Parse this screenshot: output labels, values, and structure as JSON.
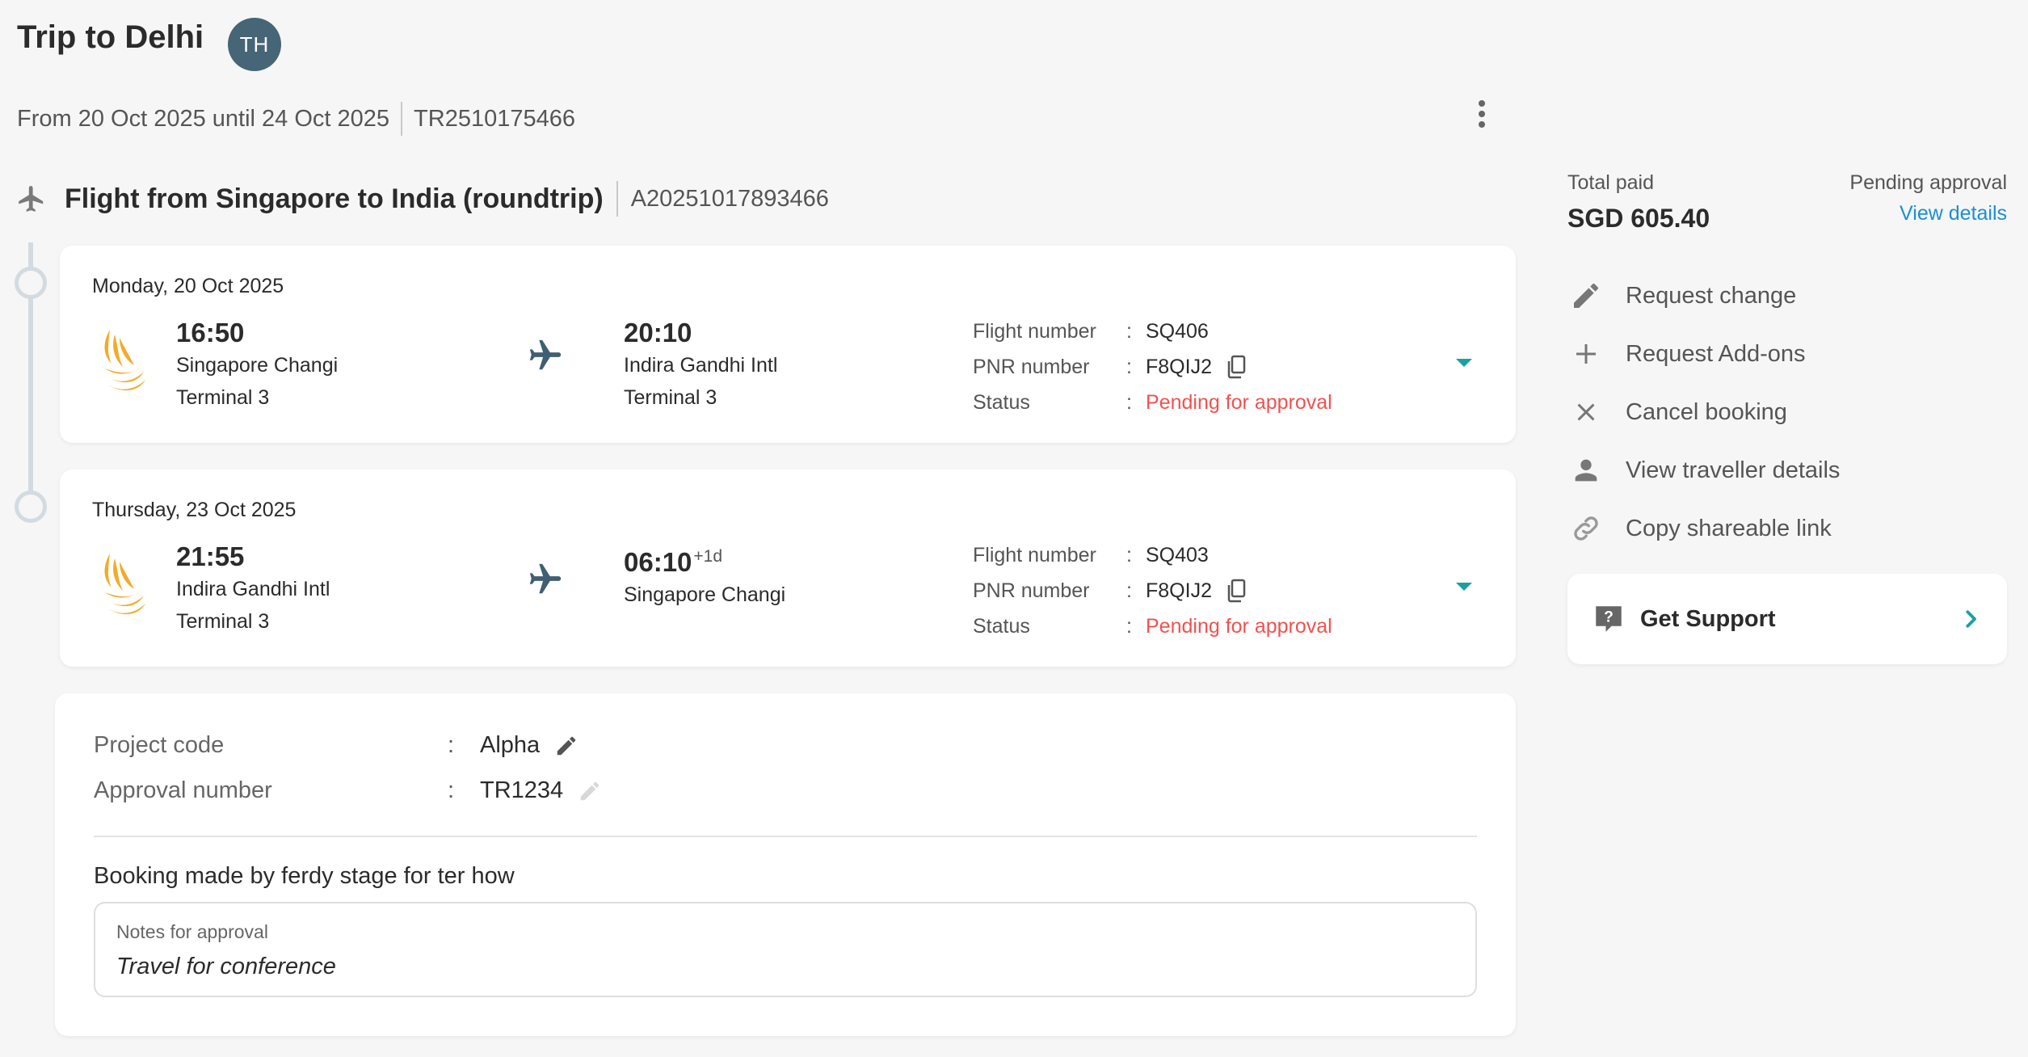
{
  "trip": {
    "title": "Trip to Delhi",
    "avatar_initials": "TH",
    "date_range": "From 20 Oct 2025 until 24 Oct 2025",
    "trip_id": "TR2510175466"
  },
  "flight": {
    "title": "Flight from Singapore to India (roundtrip)",
    "booking_id": "A20251017893466",
    "labels": {
      "flight_number": "Flight number",
      "pnr_number": "PNR number",
      "status": "Status",
      "colon": ":"
    },
    "segments": [
      {
        "date": "Monday, 20 Oct 2025",
        "dep_time": "16:50",
        "dep_airport": "Singapore Changi",
        "dep_terminal": "Terminal 3",
        "arr_time": "20:10",
        "arr_day_offset": "",
        "arr_airport": "Indira Gandhi Intl",
        "arr_terminal": "Terminal 3",
        "flight_number": "SQ406",
        "pnr": "F8QIJ2",
        "status": "Pending for approval"
      },
      {
        "date": "Thursday, 23 Oct 2025",
        "dep_time": "21:55",
        "dep_airport": "Indira Gandhi Intl",
        "dep_terminal": "Terminal 3",
        "arr_time": "06:10",
        "arr_day_offset": "+1d",
        "arr_airport": "Singapore Changi",
        "arr_terminal": "",
        "flight_number": "SQ403",
        "pnr": "F8QIJ2",
        "status": "Pending for approval"
      }
    ]
  },
  "details": {
    "colon": ":",
    "project_code_label": "Project code",
    "project_code_value": "Alpha",
    "approval_number_label": "Approval number",
    "approval_number_value": "TR1234",
    "booked_by": "Booking made by ferdy stage for ter how",
    "notes_label": "Notes for approval",
    "notes_value": "Travel for conference"
  },
  "summary": {
    "total_label": "Total paid",
    "total_value": "SGD 605.40",
    "approval_status": "Pending approval",
    "view_details": "View details"
  },
  "actions": [
    {
      "label": "Request change",
      "icon": "pencil-icon"
    },
    {
      "label": "Request Add-ons",
      "icon": "plus-icon"
    },
    {
      "label": "Cancel booking",
      "icon": "close-icon"
    },
    {
      "label": "View traveller details",
      "icon": "person-icon"
    },
    {
      "label": "Copy shareable link",
      "icon": "link-icon"
    }
  ],
  "support": {
    "label": "Get Support",
    "icon": "help-chat-icon"
  },
  "colors": {
    "accent_teal": "#17a2a1",
    "link_blue": "#1a8fd6",
    "pending_red": "#ef5350",
    "avatar_bg": "#466577",
    "airline_logo": "#f2ab2a"
  }
}
